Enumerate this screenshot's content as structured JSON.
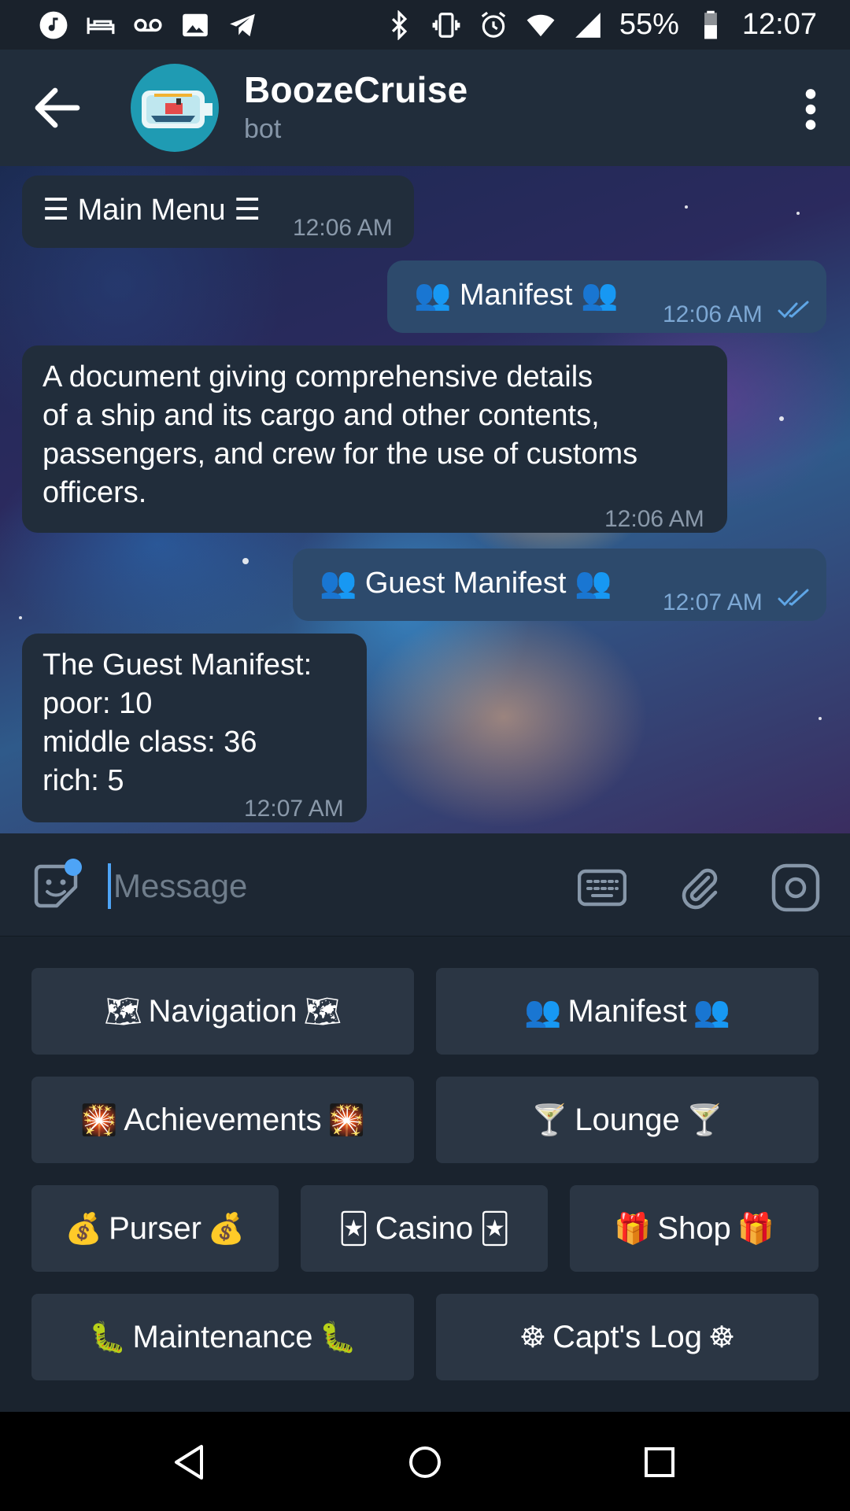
{
  "status_bar": {
    "battery": "55%",
    "time": "12:07"
  },
  "header": {
    "title": "BoozeCruise",
    "subtitle": "bot"
  },
  "messages": [
    {
      "direction": "in",
      "text": "☰ Main Menu ☰",
      "time": "12:06 AM"
    },
    {
      "direction": "out",
      "text": "👥 Manifest 👥",
      "time": "12:06 AM",
      "read": true
    },
    {
      "direction": "in",
      "lines": [
        "A document giving comprehensive details",
        "of a ship and its cargo and other contents,",
        "passengers, and crew for the use of customs",
        "officers."
      ],
      "time": "12:06 AM"
    },
    {
      "direction": "out",
      "text": "👥 Guest Manifest 👥",
      "time": "12:07 AM",
      "read": true
    },
    {
      "direction": "in",
      "lines": [
        "The Guest Manifest:",
        "poor: 10",
        "middle class: 36",
        "rich: 5"
      ],
      "time": "12:07 AM"
    }
  ],
  "input": {
    "placeholder": "Message"
  },
  "keyboard": {
    "navigation": {
      "label": "Navigation",
      "emoji": "🗺"
    },
    "manifest": {
      "label": "Manifest",
      "emoji": "👥"
    },
    "achievements": {
      "label": "Achievements",
      "emoji": "🎇"
    },
    "lounge": {
      "label": "Lounge",
      "emoji": "🍸"
    },
    "purser": {
      "label": "Purser",
      "emoji": "💰"
    },
    "casino": {
      "label": "Casino",
      "emoji": "🃏"
    },
    "shop": {
      "label": "Shop",
      "emoji": "🎁"
    },
    "maintenance": {
      "label": "Maintenance",
      "emoji": "🐛"
    },
    "capts_log": {
      "label": "Capt's Log",
      "emoji": "☸"
    }
  },
  "colors": {
    "accent": "#4ea4f6",
    "incoming_bubble": "#212d3b",
    "outgoing_bubble": "#2d4a6c",
    "keyboard_button": "#2b3644"
  }
}
